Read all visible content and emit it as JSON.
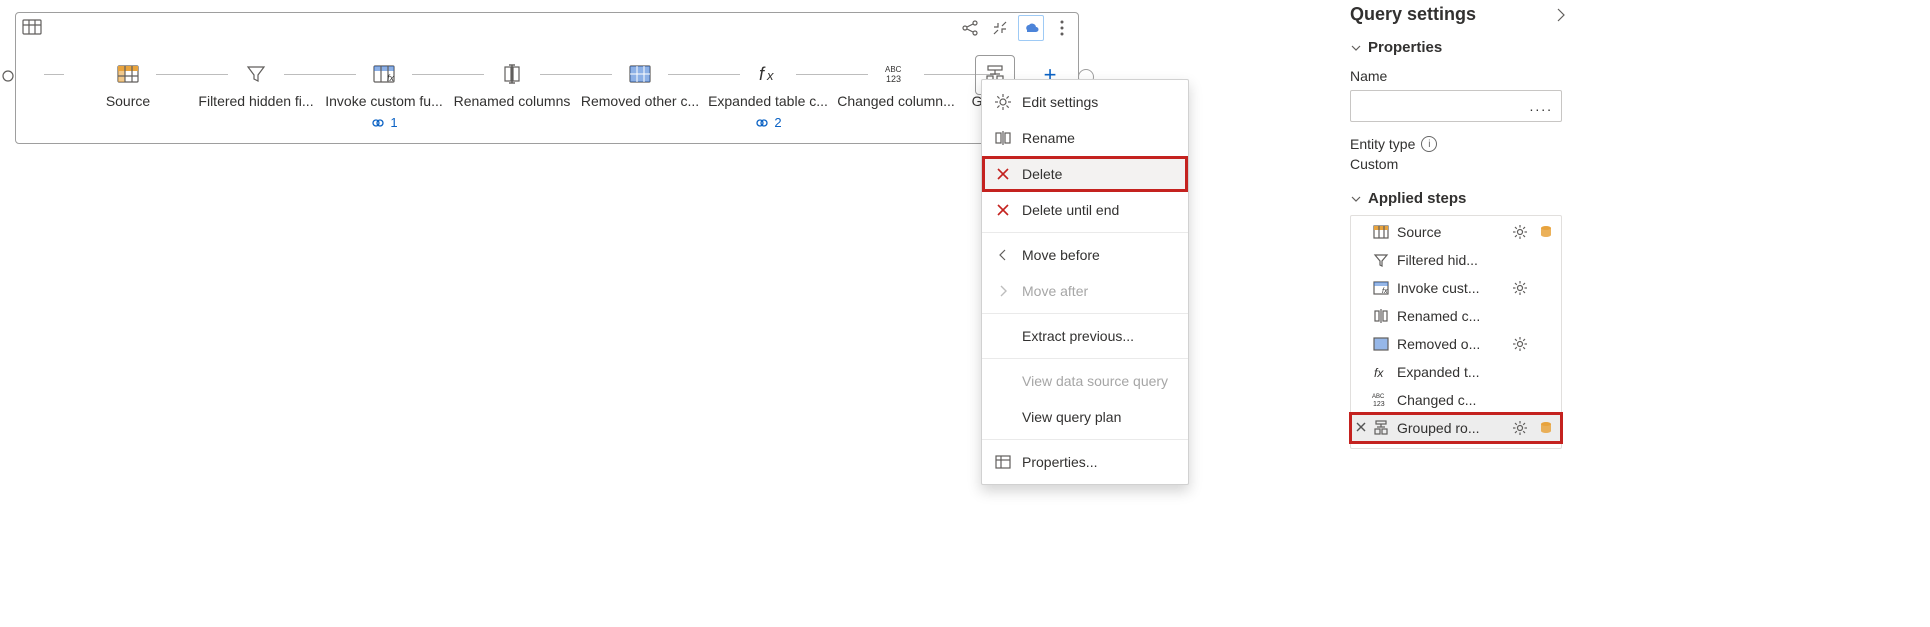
{
  "diagram": {
    "steps": [
      {
        "label": "Source",
        "badge": null
      },
      {
        "label": "Filtered hidden fi...",
        "badge": null
      },
      {
        "label": "Invoke custom fu...",
        "badge": "1"
      },
      {
        "label": "Renamed columns",
        "badge": null
      },
      {
        "label": "Removed other c...",
        "badge": null
      },
      {
        "label": "Expanded table c...",
        "badge": "2"
      },
      {
        "label": "Changed column...",
        "badge": null
      },
      {
        "label": "Groupe",
        "badge": null
      }
    ]
  },
  "context_menu": {
    "edit_settings": "Edit settings",
    "rename": "Rename",
    "delete": "Delete",
    "delete_until_end": "Delete until end",
    "move_before": "Move before",
    "move_after": "Move after",
    "extract_previous": "Extract previous...",
    "view_data_source": "View data source query",
    "view_query_plan": "View query plan",
    "properties": "Properties..."
  },
  "side_panel": {
    "title": "Query settings",
    "properties_header": "Properties",
    "name_label": "Name",
    "name_value": "",
    "entity_type_label": "Entity type",
    "entity_type_value": "Custom",
    "applied_steps_header": "Applied steps",
    "applied_steps": [
      {
        "label": "Source",
        "gear": true,
        "db": true
      },
      {
        "label": "Filtered hid...",
        "gear": false,
        "db": false
      },
      {
        "label": "Invoke cust...",
        "gear": true,
        "db": false
      },
      {
        "label": "Renamed c...",
        "gear": false,
        "db": false
      },
      {
        "label": "Removed o...",
        "gear": true,
        "db": false
      },
      {
        "label": "Expanded t...",
        "gear": false,
        "db": false
      },
      {
        "label": "Changed c...",
        "gear": false,
        "db": false
      },
      {
        "label": "Grouped ro...",
        "gear": true,
        "db": true
      }
    ]
  }
}
